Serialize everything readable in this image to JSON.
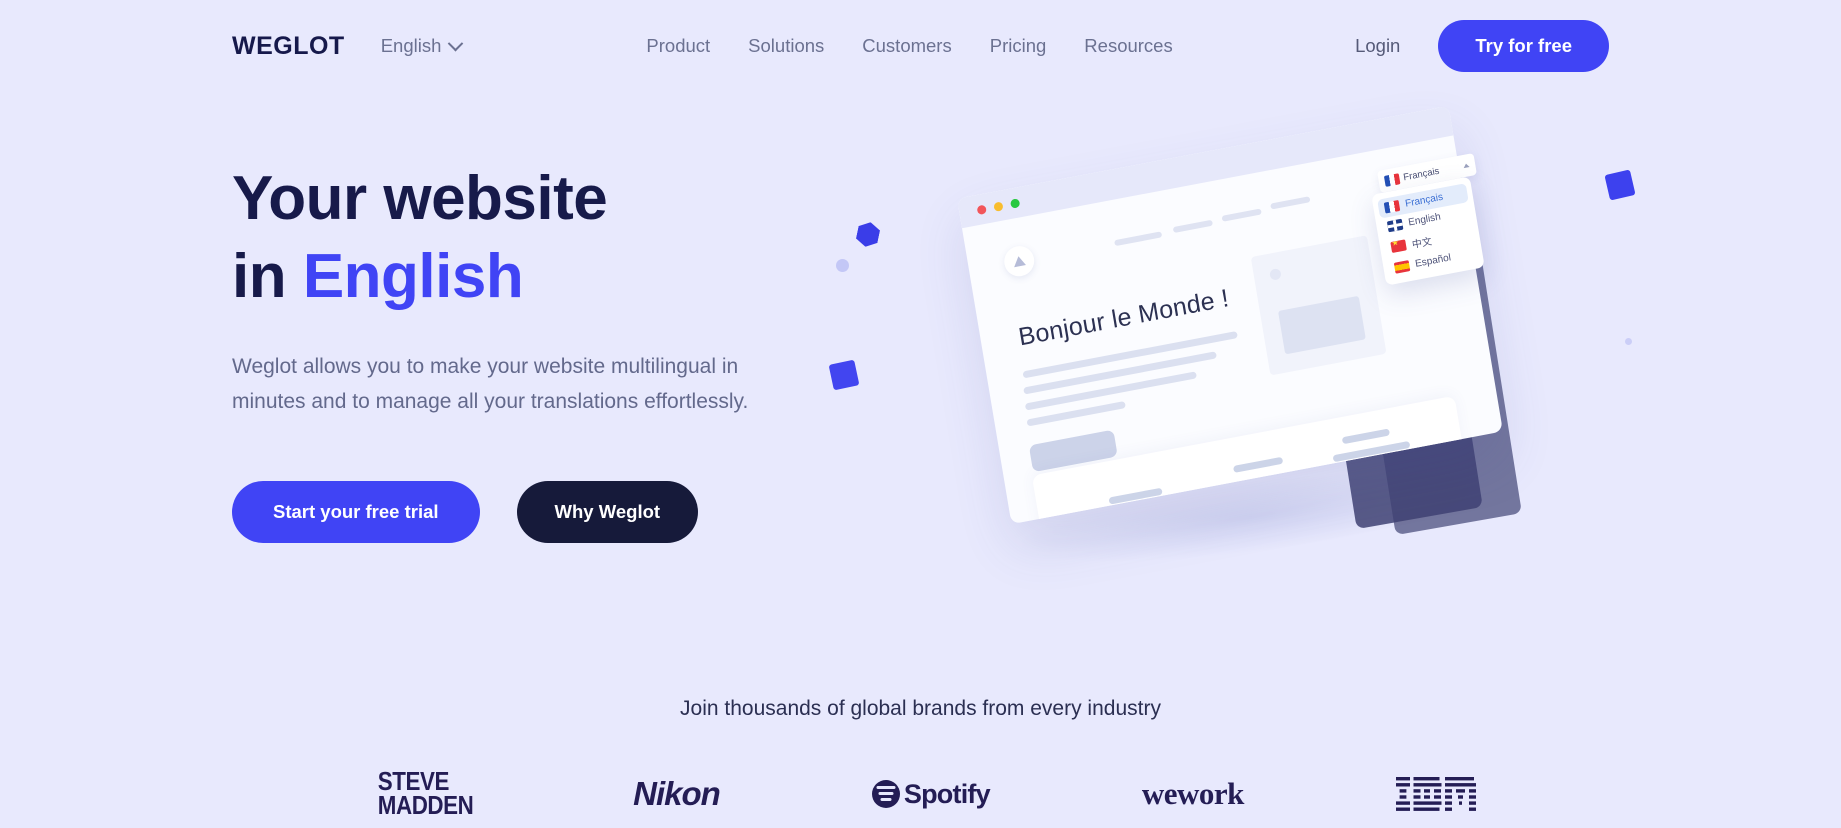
{
  "brand": {
    "logo_text": "WEGLOT",
    "accent_color": "#4044f5",
    "dark_color": "#171a4a",
    "bg_color": "#e8e9fd"
  },
  "header": {
    "language_switcher": {
      "label": "English",
      "icon": "chevron-down-icon"
    },
    "nav": [
      {
        "label": "Product"
      },
      {
        "label": "Solutions"
      },
      {
        "label": "Customers"
      },
      {
        "label": "Pricing"
      },
      {
        "label": "Resources"
      }
    ],
    "login_label": "Login",
    "cta_label": "Try for free"
  },
  "hero": {
    "headline_line1": "Your website",
    "headline_line2_prefix": "in ",
    "headline_line2_accent": "English",
    "subhead": "Weglot allows you to make your website multilingual in minutes and to manage all your translations effortlessly.",
    "cta_primary": "Start your free trial",
    "cta_secondary": "Why Weglot"
  },
  "illustration": {
    "headline": "Bonjour le Monde !",
    "current_language": "Français",
    "languages": [
      {
        "label": "Français",
        "flag": "flag-fr",
        "selected": true
      },
      {
        "label": "English",
        "flag": "flag-uk",
        "selected": false
      },
      {
        "label": "中文",
        "flag": "flag-cn",
        "selected": false
      },
      {
        "label": "Español",
        "flag": "flag-es",
        "selected": false
      }
    ]
  },
  "brands": {
    "title": "Join thousands of global brands from every industry",
    "items": [
      {
        "name": "Steve Madden",
        "line1": "STEVE",
        "line2": "MADDEN"
      },
      {
        "name": "Nikon",
        "label": "Nikon"
      },
      {
        "name": "Spotify",
        "label": "Spotify"
      },
      {
        "name": "WeWork",
        "label": "wework"
      },
      {
        "name": "IBM",
        "label": "IBM"
      }
    ]
  }
}
